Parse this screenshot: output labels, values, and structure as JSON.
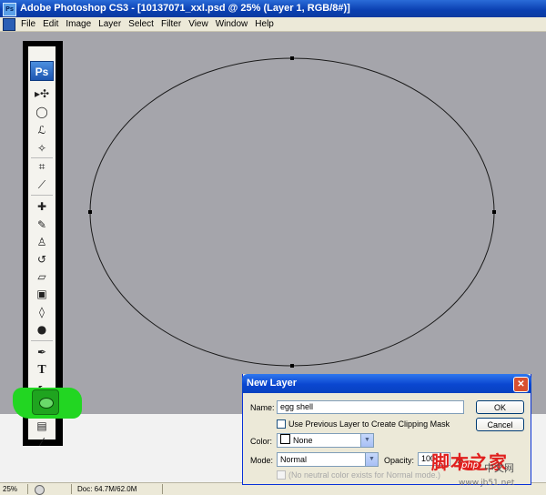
{
  "window": {
    "app_badge": "Ps",
    "title": "Adobe Photoshop CS3 - [10137071_xxl.psd @ 25% (Layer 1, RGB/8#)]"
  },
  "menu": [
    "File",
    "Edit",
    "Image",
    "Layer",
    "Select",
    "Filter",
    "View",
    "Window",
    "Help"
  ],
  "toolbar": {
    "logo": "Ps",
    "tools": [
      {
        "name": "move-tool-icon",
        "glyph": "▸✣"
      },
      {
        "name": "elliptical-marquee-icon",
        "glyph": "◯"
      },
      {
        "name": "lasso-icon",
        "glyph": "ℒ"
      },
      {
        "name": "magic-wand-icon",
        "glyph": "✧"
      },
      {
        "name": "crop-icon",
        "glyph": "⌗"
      },
      {
        "name": "slice-icon",
        "glyph": "⟋"
      },
      {
        "name": "healing-brush-icon",
        "glyph": "✚"
      },
      {
        "name": "brush-icon",
        "glyph": "✎"
      },
      {
        "name": "clone-stamp-icon",
        "glyph": "♙"
      },
      {
        "name": "history-brush-icon",
        "glyph": "↺"
      },
      {
        "name": "eraser-icon",
        "glyph": "▱"
      },
      {
        "name": "gradient-icon",
        "glyph": "▣"
      },
      {
        "name": "blur-icon",
        "glyph": "◊"
      },
      {
        "name": "dodge-icon",
        "glyph": "●"
      },
      {
        "name": "pen-icon",
        "glyph": "✒"
      },
      {
        "name": "type-icon",
        "glyph": "T"
      },
      {
        "name": "path-selection-icon",
        "glyph": "↖"
      }
    ],
    "highlighted_tool": "shape-ellipse-icon",
    "notes_glyph": "▤",
    "eyedropper_glyph": "⁄"
  },
  "canvas": {
    "background": "#a5a5ab"
  },
  "status": {
    "zoom": "25%",
    "doc": "Doc: 64.7M/62.0M"
  },
  "dialog": {
    "title": "New Layer",
    "close": "✕",
    "name_label": "Name:",
    "name_value": "egg shell",
    "clip_label": "Use Previous Layer to Create Clipping Mask",
    "color_label": "Color:",
    "color_value": "None",
    "mode_label": "Mode:",
    "mode_value": "Normal",
    "opacity_label": "Opacity:",
    "opacity_value": "100",
    "opacity_unit": "%",
    "neutral_label": "(No neutral color exists for Normal mode.)",
    "ok": "OK",
    "cancel": "Cancel"
  },
  "watermark": {
    "cn": "脚本之家",
    "badge": "php",
    "sub": "中文网",
    "url": "www.jb51.net"
  }
}
